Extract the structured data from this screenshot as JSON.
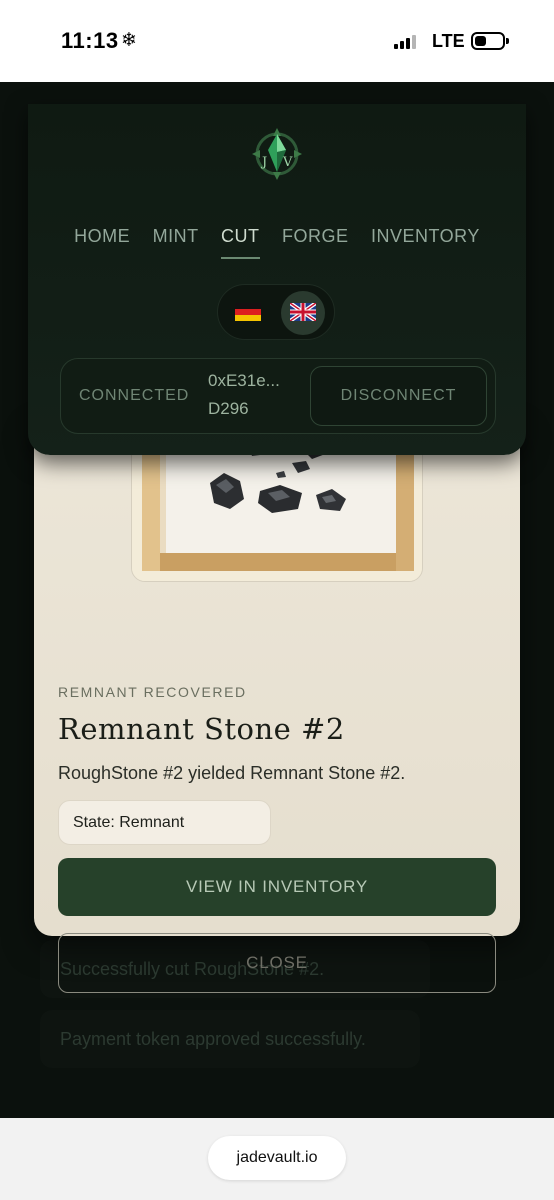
{
  "status_bar": {
    "time": "11:13",
    "weather_icon": "❄",
    "network": "LTE",
    "battery_level": 0.35
  },
  "nav": {
    "logo_icon": "jade-crest-icon",
    "items": [
      {
        "label": "HOME",
        "active": false
      },
      {
        "label": "MINT",
        "active": false
      },
      {
        "label": "CUT",
        "active": true
      },
      {
        "label": "FORGE",
        "active": false
      },
      {
        "label": "INVENTORY",
        "active": false
      }
    ],
    "languages": [
      {
        "icon": "german-flag-icon",
        "selected": false
      },
      {
        "icon": "uk-flag-icon",
        "selected": true
      }
    ],
    "wallet": {
      "status": "CONNECTED",
      "address_line1": "0xE31e...",
      "address_line2": "D296",
      "disconnect_label": "DISCONNECT"
    }
  },
  "modal": {
    "eyebrow": "REMNANT RECOVERED",
    "title": "Remnant Stone #2",
    "description": "RoughStone #2 yielded Remnant Stone #2.",
    "state_pill": "State: Remnant",
    "primary_button": "VIEW IN INVENTORY",
    "secondary_button": "CLOSE"
  },
  "toasts": [
    "Successfully cut RoughStone #2.",
    "Payment token approved successfully."
  ],
  "browser": {
    "url": "jadevault.io"
  },
  "colors": {
    "app_background": "#0b110d",
    "nav_background": "#142119",
    "card_background": "#ece6d8",
    "primary_button": "#26412a",
    "accent_text": "#cfdccf"
  }
}
